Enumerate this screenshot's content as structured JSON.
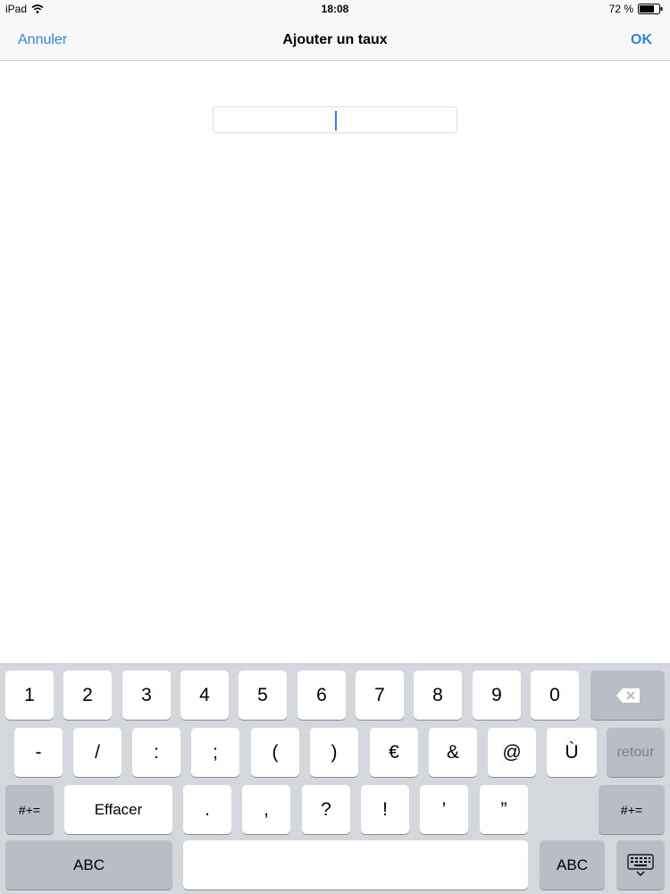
{
  "status_bar": {
    "device": "iPad",
    "time": "18:08",
    "battery": "72 %",
    "icons": {
      "wifi": "wifi-icon",
      "battery": "battery-icon"
    }
  },
  "nav": {
    "cancel_label": "Annuler",
    "title": "Ajouter un taux",
    "ok_label": "OK"
  },
  "rate_input": {
    "value": "",
    "placeholder": ""
  },
  "keyboard": {
    "row1": [
      "1",
      "2",
      "3",
      "4",
      "5",
      "6",
      "7",
      "8",
      "9",
      "0"
    ],
    "row2": [
      "-",
      "/",
      ":",
      ";",
      "(",
      ")",
      "€",
      "&",
      "@",
      "Ù"
    ],
    "row3": [
      ".",
      ",",
      "?",
      "!",
      "’",
      "”"
    ],
    "return_label": "retour",
    "symbols_label": "#+=",
    "clear_label": "Effacer",
    "abc_label": "ABC",
    "icons": {
      "backspace": "backspace-icon",
      "hide_keyboard": "hide-keyboard-icon"
    }
  },
  "colors": {
    "accent": "#2e86de",
    "keyboard_bg": "#d4d7dc",
    "function_key": "#b8bdc6"
  }
}
